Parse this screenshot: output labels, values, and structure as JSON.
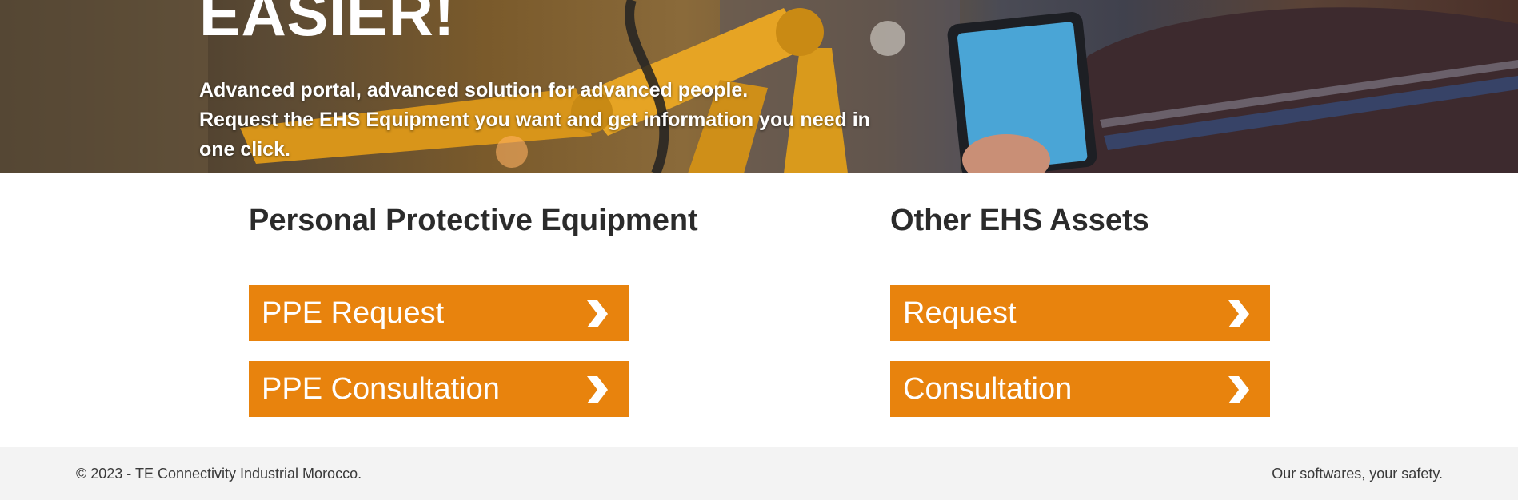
{
  "hero": {
    "title": "EASIER!",
    "line1": "Advanced portal, advanced solution for advanced people.",
    "line2": "Request the EHS Equipment you want and get information you need in one click."
  },
  "sections": {
    "ppe": {
      "title": "Personal Protective Equipment",
      "request_label": "PPE Request",
      "consultation_label": "PPE Consultation"
    },
    "other": {
      "title": "Other EHS Assets",
      "request_label": "Request",
      "consultation_label": "Consultation"
    }
  },
  "footer": {
    "copyright": "© 2023 - TE Connectivity Industrial Morocco.",
    "tagline": "Our softwares, your safety."
  },
  "colors": {
    "accent": "#e8830d",
    "heading": "#2b2b2b",
    "footer_bg": "#f3f3f3"
  },
  "icons": {
    "button_arrow": "chevron-right-icon"
  }
}
